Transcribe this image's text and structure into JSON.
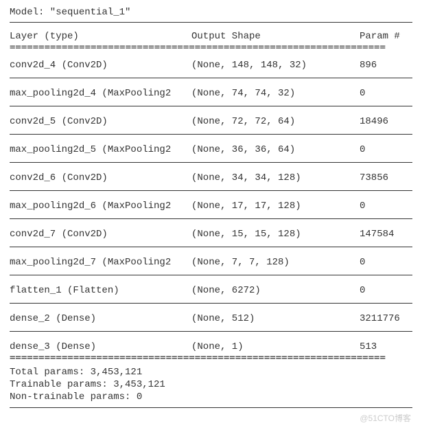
{
  "model_title": "Model: \"sequential_1\"",
  "header": {
    "layer": "Layer (type)",
    "shape": "Output Shape",
    "param": "Param #"
  },
  "rows": [
    {
      "layer": "conv2d_4 (Conv2D)",
      "shape": "(None, 148, 148, 32)",
      "param": "896"
    },
    {
      "layer": "max_pooling2d_4 (MaxPooling2",
      "shape": "(None, 74, 74, 32)",
      "param": "0"
    },
    {
      "layer": "conv2d_5 (Conv2D)",
      "shape": "(None, 72, 72, 64)",
      "param": "18496"
    },
    {
      "layer": "max_pooling2d_5 (MaxPooling2",
      "shape": "(None, 36, 36, 64)",
      "param": "0"
    },
    {
      "layer": "conv2d_6 (Conv2D)",
      "shape": "(None, 34, 34, 128)",
      "param": "73856"
    },
    {
      "layer": "max_pooling2d_6 (MaxPooling2",
      "shape": "(None, 17, 17, 128)",
      "param": "0"
    },
    {
      "layer": "conv2d_7 (Conv2D)",
      "shape": "(None, 15, 15, 128)",
      "param": "147584"
    },
    {
      "layer": "max_pooling2d_7 (MaxPooling2",
      "shape": "(None, 7, 7, 128)",
      "param": "0"
    },
    {
      "layer": "flatten_1 (Flatten)",
      "shape": "(None, 6272)",
      "param": "0"
    },
    {
      "layer": "dense_2 (Dense)",
      "shape": "(None, 512)",
      "param": "3211776"
    },
    {
      "layer": "dense_3 (Dense)",
      "shape": "(None, 1)",
      "param": "513"
    }
  ],
  "footer": {
    "total": "Total params: 3,453,121",
    "trainable": "Trainable params: 3,453,121",
    "nontrainable": "Non-trainable params: 0"
  },
  "watermark": "@51CTO博客",
  "eqline": "================================================================="
}
